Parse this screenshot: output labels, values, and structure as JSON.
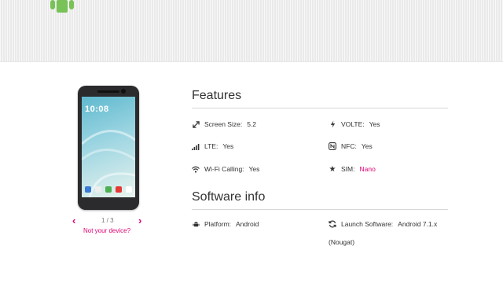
{
  "header": {
    "logo_icon": "android-icon"
  },
  "device": {
    "screen_clock": "10:08",
    "pager": {
      "current": "1",
      "total": "3",
      "text": "1 / 3"
    },
    "not_your_device": "Not your device?"
  },
  "features": {
    "title": "Features",
    "items": [
      {
        "icon": "expand-icon",
        "label": "Screen Size:",
        "value": "5.2"
      },
      {
        "icon": "volte-icon",
        "label": "VOLTE:",
        "value": "Yes"
      },
      {
        "icon": "signal-bars-icon",
        "label": "LTE:",
        "value": "Yes"
      },
      {
        "icon": "nfc-icon",
        "label": "NFC:",
        "value": "Yes"
      },
      {
        "icon": "wifi-icon",
        "label": "Wi-Fi Calling:",
        "value": "Yes"
      },
      {
        "icon": "star-icon",
        "label": "SIM:",
        "value": "Nano"
      }
    ]
  },
  "software": {
    "title": "Software info",
    "items": [
      {
        "icon": "android-icon",
        "label": "Platform:",
        "value": "Android"
      },
      {
        "icon": "refresh-icon",
        "label": "Launch Software:",
        "value": "Android 7.1.x",
        "value_cont": "(Nougat)"
      }
    ]
  },
  "colors": {
    "accent": "#e20074",
    "banner": "#efefef"
  }
}
